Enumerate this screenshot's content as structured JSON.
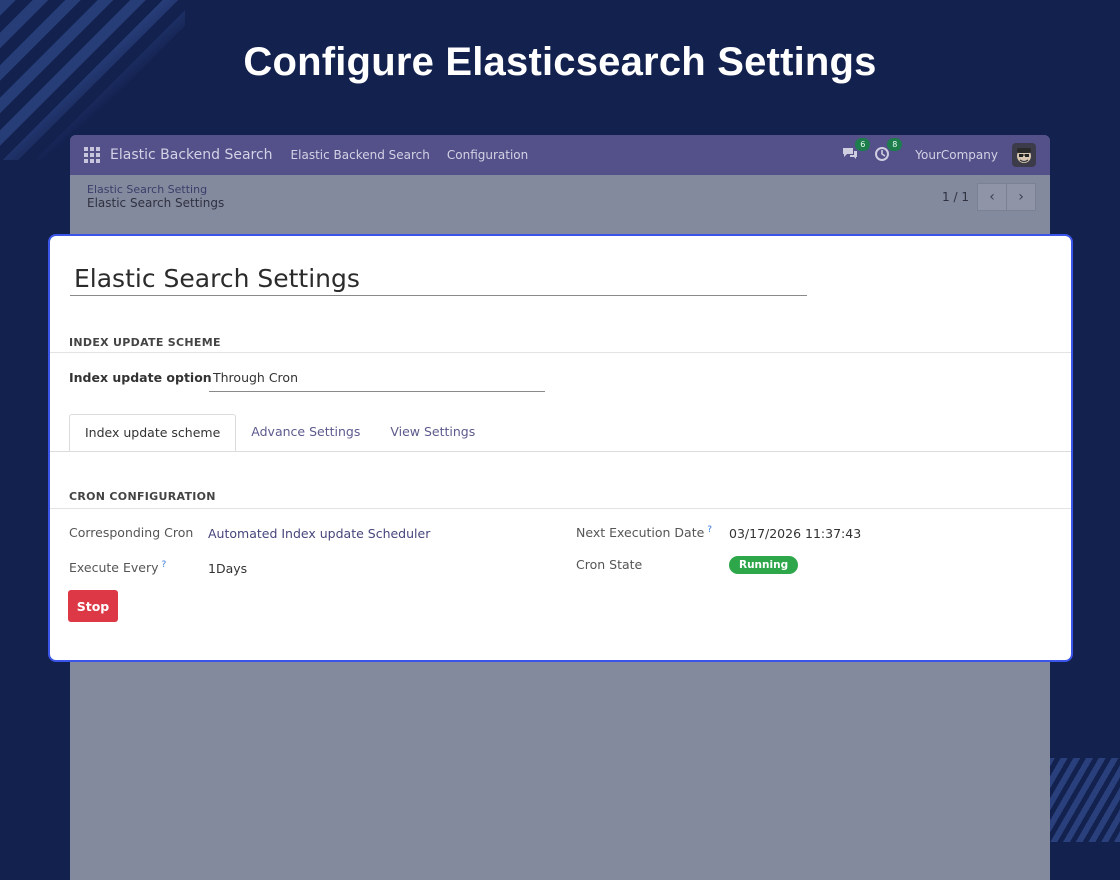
{
  "banner": {
    "title": "Configure Elasticsearch Settings"
  },
  "navbar": {
    "app_name": "Elastic Backend Search",
    "menu": [
      "Elastic Backend Search",
      "Configuration"
    ],
    "messages_count": "6",
    "activities_count": "8",
    "company": "YourCompany",
    "icons": {
      "apps": "apps-grid-icon",
      "messages": "chat-icon",
      "activities": "clock-icon",
      "user": "user-avatar"
    }
  },
  "breadcrumb": {
    "parent": "Elastic Search Setting",
    "current": "Elastic Search Settings"
  },
  "pager": {
    "value": "1 / 1",
    "prev": "‹",
    "next": "›"
  },
  "form": {
    "title": "Elastic Search Settings",
    "section_index": "INDEX UPDATE SCHEME",
    "index_update_label": "Index update option",
    "index_update_value": "Through Cron",
    "tabs": [
      "Index update scheme",
      "Advance Settings",
      "View Settings"
    ],
    "active_tab": 0,
    "section_cron": "CRON CONFIGURATION",
    "corresponding_cron_label": "Corresponding Cron",
    "corresponding_cron_value": "Automated Index update Scheduler",
    "execute_every_label": "Execute Every",
    "execute_every_value": "1Days",
    "next_execution_label": "Next Execution Date",
    "next_execution_value": "03/17/2026 11:37:43",
    "cron_state_label": "Cron State",
    "cron_state_value": "Running",
    "help_marker": "?",
    "stop_label": "Stop"
  },
  "colors": {
    "background": "#13214f",
    "navbar": "#53508a",
    "card_border": "#3b55e8",
    "running": "#2ea64a",
    "stop": "#dc3845"
  }
}
